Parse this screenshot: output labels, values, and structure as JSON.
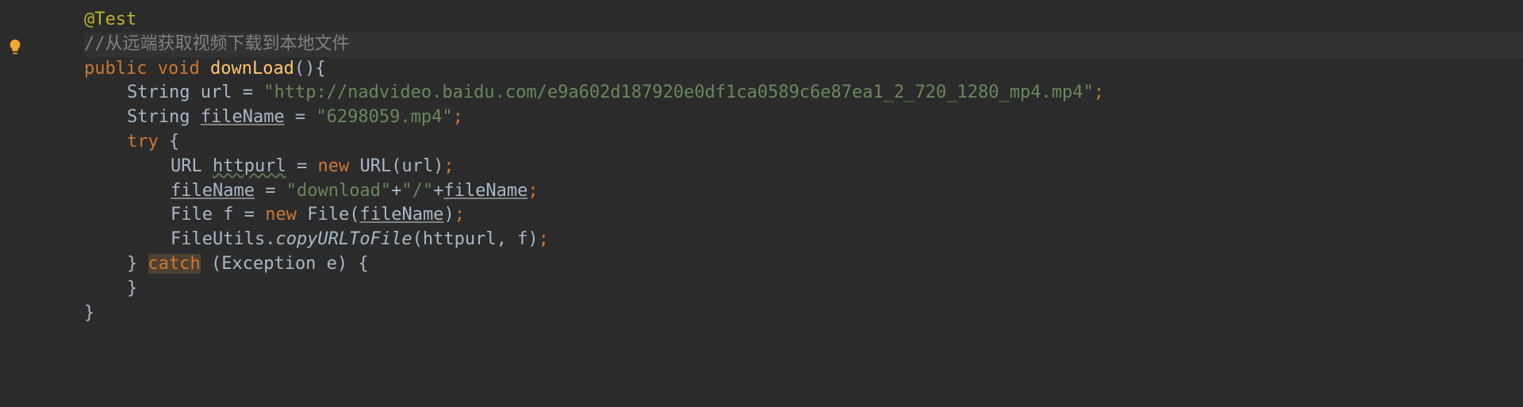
{
  "code": {
    "line1": {
      "annotation": "@Test"
    },
    "line2": {
      "comment": "//从远端获取视频下载到本地文件"
    },
    "line3": {
      "kw_public": "public",
      "kw_void": "void",
      "method": "downLoad",
      "parens": "(){"
    },
    "line4": {
      "type": "String ",
      "var": "url",
      "eq": " = ",
      "str": "\"http://nadvideo.baidu.com/e9a602d187920e0df1ca0589c6e87ea1_2_720_1280_mp4.mp4\"",
      "semi": ";"
    },
    "line5": {
      "type": "String ",
      "var": "fileName",
      "eq": " = ",
      "str": "\"6298059.mp4\"",
      "semi": ";"
    },
    "line6": {
      "kw_try": "try",
      "brace": " {"
    },
    "line7": {
      "type": "URL ",
      "var": "httpurl",
      "eq": " = ",
      "kw_new": "new",
      "ctor": " URL(url)",
      "semi": ";"
    },
    "line8": {
      "var": "fileName",
      "eq": " = ",
      "str1": "\"download\"",
      "plus1": "+",
      "str2": "\"/\"",
      "plus2": "+",
      "var2": "fileName",
      "semi": ";"
    },
    "line9": {
      "type": "File ",
      "var": "f",
      "eq": " = ",
      "kw_new": "new",
      "ctor1": " File(",
      "arg": "fileName",
      "ctor2": ")",
      "semi": ";"
    },
    "line10": {
      "call1": "FileUtils.",
      "method": "copyURLToFile",
      "args": "(httpurl, f)",
      "semi": ";"
    },
    "line11": {
      "brace1": "} ",
      "kw_catch": "catch",
      "rest": " (Exception e) {"
    },
    "line12": {
      "brace": "}"
    },
    "line13": {
      "brace": "}"
    },
    "line14": {
      "brace": ""
    }
  },
  "icons": {
    "bulb": "lightbulb-icon"
  }
}
